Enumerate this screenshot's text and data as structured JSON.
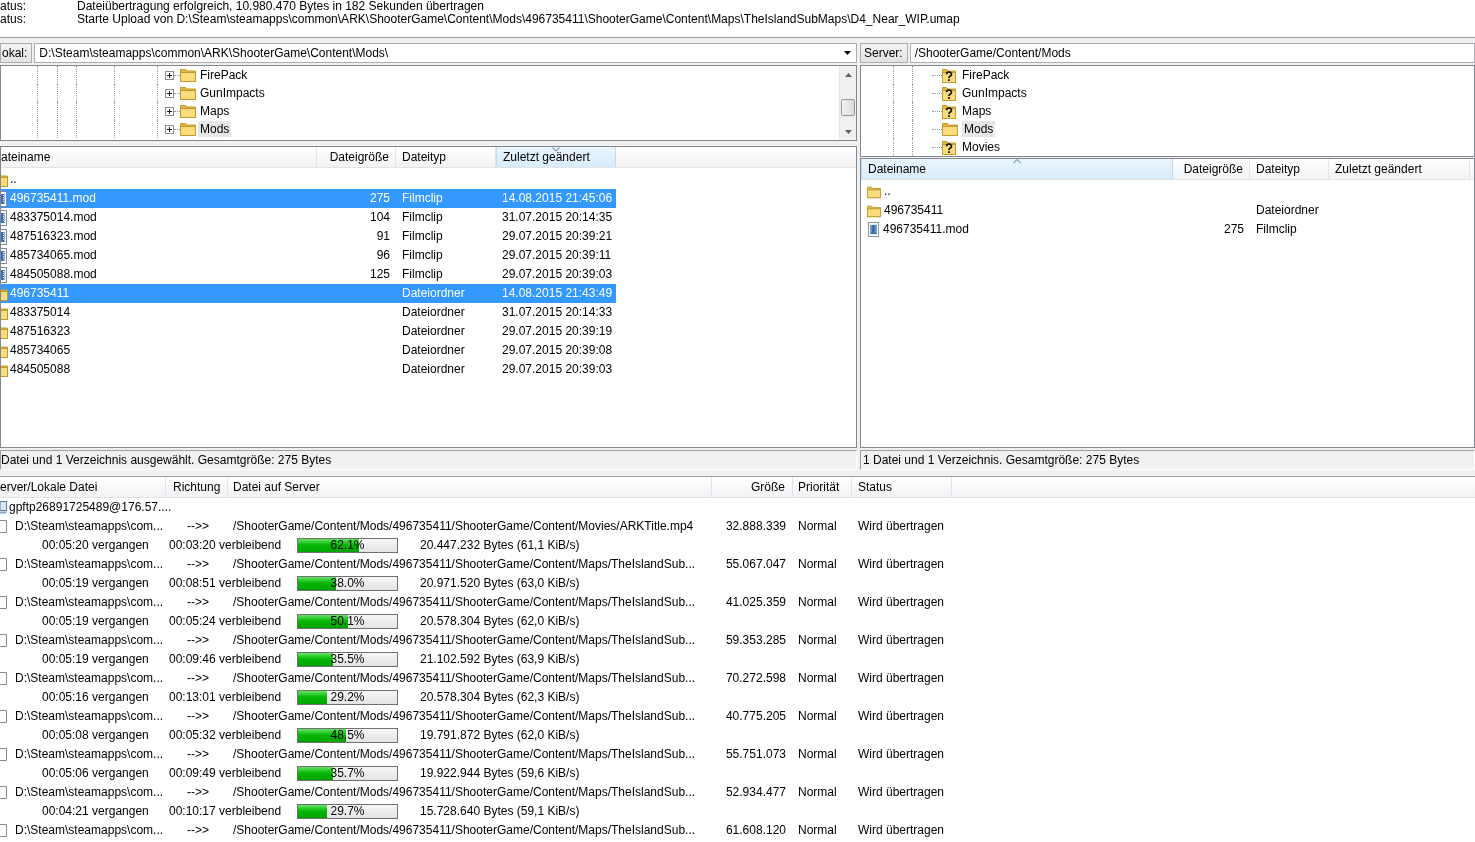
{
  "message_log": [
    {
      "label": "atus:",
      "text": "Dateiübertragung erfolgreich, 10.980.470 Bytes in 182 Sekunden übertragen"
    },
    {
      "label": "atus:",
      "text": "Starte Upload von D:\\Steam\\steamapps\\common\\ARK\\ShooterGame\\Content\\Mods\\496735411\\ShooterGame\\Content\\Maps\\TheIslandSubMaps\\D4_Near_WIP.umap"
    }
  ],
  "local": {
    "label": "okal:",
    "path": "D:\\Steam\\steamapps\\common\\ARK\\ShooterGame\\Content\\Mods\\",
    "tree": [
      {
        "name": "FirePack",
        "kind": "folder",
        "expanded": false,
        "selected": false
      },
      {
        "name": "GunImpacts",
        "kind": "folder",
        "expanded": false,
        "selected": false
      },
      {
        "name": "Maps",
        "kind": "folder",
        "expanded": false,
        "selected": false
      },
      {
        "name": "Mods",
        "kind": "folder",
        "expanded": false,
        "selected": true
      }
    ],
    "columns": [
      {
        "label": "ateiname",
        "sorted": false
      },
      {
        "label": "Dateigröße",
        "sorted": false
      },
      {
        "label": "Dateityp",
        "sorted": false
      },
      {
        "label": "Zuletzt geändert",
        "sorted": true,
        "descending": true
      }
    ],
    "files": [
      {
        "kind": "folder",
        "name": "..",
        "selected": false
      },
      {
        "kind": "file",
        "name": "496735411.mod",
        "size": "275",
        "type": "Filmclip",
        "modified": "14.08.2015 21:45:06",
        "selected": true
      },
      {
        "kind": "file",
        "name": "483375014.mod",
        "size": "104",
        "type": "Filmclip",
        "modified": "31.07.2015 20:14:35",
        "selected": false
      },
      {
        "kind": "file",
        "name": "487516323.mod",
        "size": "91",
        "type": "Filmclip",
        "modified": "29.07.2015 20:39:21",
        "selected": false
      },
      {
        "kind": "file",
        "name": "485734065.mod",
        "size": "96",
        "type": "Filmclip",
        "modified": "29.07.2015 20:39:11",
        "selected": false
      },
      {
        "kind": "file",
        "name": "484505088.mod",
        "size": "125",
        "type": "Filmclip",
        "modified": "29.07.2015 20:39:03",
        "selected": false
      },
      {
        "kind": "folder",
        "name": "496735411",
        "type": "Dateiordner",
        "modified": "14.08.2015 21:43:49",
        "selected": true
      },
      {
        "kind": "folder",
        "name": "483375014",
        "type": "Dateiordner",
        "modified": "31.07.2015 20:14:33",
        "selected": false
      },
      {
        "kind": "folder",
        "name": "487516323",
        "type": "Dateiordner",
        "modified": "29.07.2015 20:39:19",
        "selected": false
      },
      {
        "kind": "folder",
        "name": "485734065",
        "type": "Dateiordner",
        "modified": "29.07.2015 20:39:08",
        "selected": false
      },
      {
        "kind": "folder",
        "name": "484505088",
        "type": "Dateiordner",
        "modified": "29.07.2015 20:39:03",
        "selected": false
      }
    ],
    "status": "Datei und 1 Verzeichnis ausgewählt. Gesamtgröße: 275 Bytes"
  },
  "remote": {
    "label": "Server:",
    "path": "/ShooterGame/Content/Mods",
    "tree": [
      {
        "name": "FirePack",
        "kind": "unknown",
        "selected": false
      },
      {
        "name": "GunImpacts",
        "kind": "unknown",
        "selected": false
      },
      {
        "name": "Maps",
        "kind": "unknown",
        "selected": false
      },
      {
        "name": "Mods",
        "kind": "folder",
        "selected": true
      },
      {
        "name": "Movies",
        "kind": "unknown",
        "selected": false
      }
    ],
    "columns": [
      {
        "label": "Dateiname",
        "sorted": true,
        "descending": false
      },
      {
        "label": "Dateigröße",
        "sorted": false
      },
      {
        "label": "Dateityp",
        "sorted": false
      },
      {
        "label": "Zuletzt geändert",
        "sorted": false
      }
    ],
    "files": [
      {
        "kind": "folder",
        "name": "..",
        "selected": false
      },
      {
        "kind": "folder",
        "name": "496735411",
        "type": "Dateiordner",
        "selected": false
      },
      {
        "kind": "file",
        "name": "496735411.mod",
        "size": "275",
        "type": "Filmclip",
        "selected": false
      }
    ],
    "status": "1 Datei und 1 Verzeichnis. Gesamtgröße: 275 Bytes"
  },
  "queue": {
    "columns": [
      "erver/Lokale Datei",
      "Richtung",
      "Datei auf Server",
      "Größe",
      "Priorität",
      "Status"
    ],
    "server": "gpftp26891725489@176.57....",
    "transfers": [
      {
        "local": "D:\\Steam\\steamapps\\com...",
        "direction": "-->>",
        "remote": "/ShooterGame/Content/Mods/496735411/ShooterGame/Content/Movies/ARKTitle.mp4",
        "size": "32.888.339",
        "priority": "Normal",
        "status": "Wird übertragen",
        "elapsed": "00:05:20 vergangen",
        "remaining": "00:03:20 verbleibend",
        "level": 0.621,
        "percent": "62.1%",
        "bytes": "20.447.232 Bytes (61,1 KiB/s)"
      },
      {
        "local": "D:\\Steam\\steamapps\\com...",
        "direction": "-->>",
        "remote": "/ShooterGame/Content/Mods/496735411/ShooterGame/Content/Maps/TheIslandSub...",
        "size": "55.067.047",
        "priority": "Normal",
        "status": "Wird übertragen",
        "elapsed": "00:05:19 vergangen",
        "remaining": "00:08:51 verbleibend",
        "level": 0.38,
        "percent": "38.0%",
        "bytes": "20.971.520 Bytes (63,0 KiB/s)"
      },
      {
        "local": "D:\\Steam\\steamapps\\com...",
        "direction": "-->>",
        "remote": "/ShooterGame/Content/Mods/496735411/ShooterGame/Content/Maps/TheIslandSub...",
        "size": "41.025.359",
        "priority": "Normal",
        "status": "Wird übertragen",
        "elapsed": "00:05:19 vergangen",
        "remaining": "00:05:24 verbleibend",
        "level": 0.501,
        "percent": "50.1%",
        "bytes": "20.578.304 Bytes (62,0 KiB/s)"
      },
      {
        "local": "D:\\Steam\\steamapps\\com...",
        "direction": "-->>",
        "remote": "/ShooterGame/Content/Mods/496735411/ShooterGame/Content/Maps/TheIslandSub...",
        "size": "59.353.285",
        "priority": "Normal",
        "status": "Wird übertragen",
        "elapsed": "00:05:19 vergangen",
        "remaining": "00:09:46 verbleibend",
        "level": 0.355,
        "percent": "35.5%",
        "bytes": "21.102.592 Bytes (63,9 KiB/s)"
      },
      {
        "local": "D:\\Steam\\steamapps\\com...",
        "direction": "-->>",
        "remote": "/ShooterGame/Content/Mods/496735411/ShooterGame/Content/Maps/TheIslandSub...",
        "size": "70.272.598",
        "priority": "Normal",
        "status": "Wird übertragen",
        "elapsed": "00:05:16 vergangen",
        "remaining": "00:13:01 verbleibend",
        "level": 0.292,
        "percent": "29.2%",
        "bytes": "20.578.304 Bytes (62,3 KiB/s)"
      },
      {
        "local": "D:\\Steam\\steamapps\\com...",
        "direction": "-->>",
        "remote": "/ShooterGame/Content/Mods/496735411/ShooterGame/Content/Maps/TheIslandSub...",
        "size": "40.775.205",
        "priority": "Normal",
        "status": "Wird übertragen",
        "elapsed": "00:05:08 vergangen",
        "remaining": "00:05:32 verbleibend",
        "level": 0.485,
        "percent": "48.5%",
        "bytes": "19.791.872 Bytes (62,0 KiB/s)"
      },
      {
        "local": "D:\\Steam\\steamapps\\com...",
        "direction": "-->>",
        "remote": "/ShooterGame/Content/Mods/496735411/ShooterGame/Content/Maps/TheIslandSub...",
        "size": "55.751.073",
        "priority": "Normal",
        "status": "Wird übertragen",
        "elapsed": "00:05:06 vergangen",
        "remaining": "00:09:49 verbleibend",
        "level": 0.357,
        "percent": "35.7%",
        "bytes": "19.922.944 Bytes (59,6 KiB/s)"
      },
      {
        "local": "D:\\Steam\\steamapps\\com...",
        "direction": "-->>",
        "remote": "/ShooterGame/Content/Mods/496735411/ShooterGame/Content/Maps/TheIslandSub...",
        "size": "52.934.477",
        "priority": "Normal",
        "status": "Wird übertragen",
        "elapsed": "00:04:21 vergangen",
        "remaining": "00:10:17 verbleibend",
        "level": 0.297,
        "percent": "29.7%",
        "bytes": "15.728.640 Bytes (59,1 KiB/s)"
      },
      {
        "local": "D:\\Steam\\steamapps\\com...",
        "direction": "-->>",
        "remote": "/ShooterGame/Content/Mods/496735411/ShooterGame/Content/Maps/TheIslandSub...",
        "size": "61.608.120",
        "priority": "Normal",
        "status": "Wird übertragen"
      }
    ]
  }
}
